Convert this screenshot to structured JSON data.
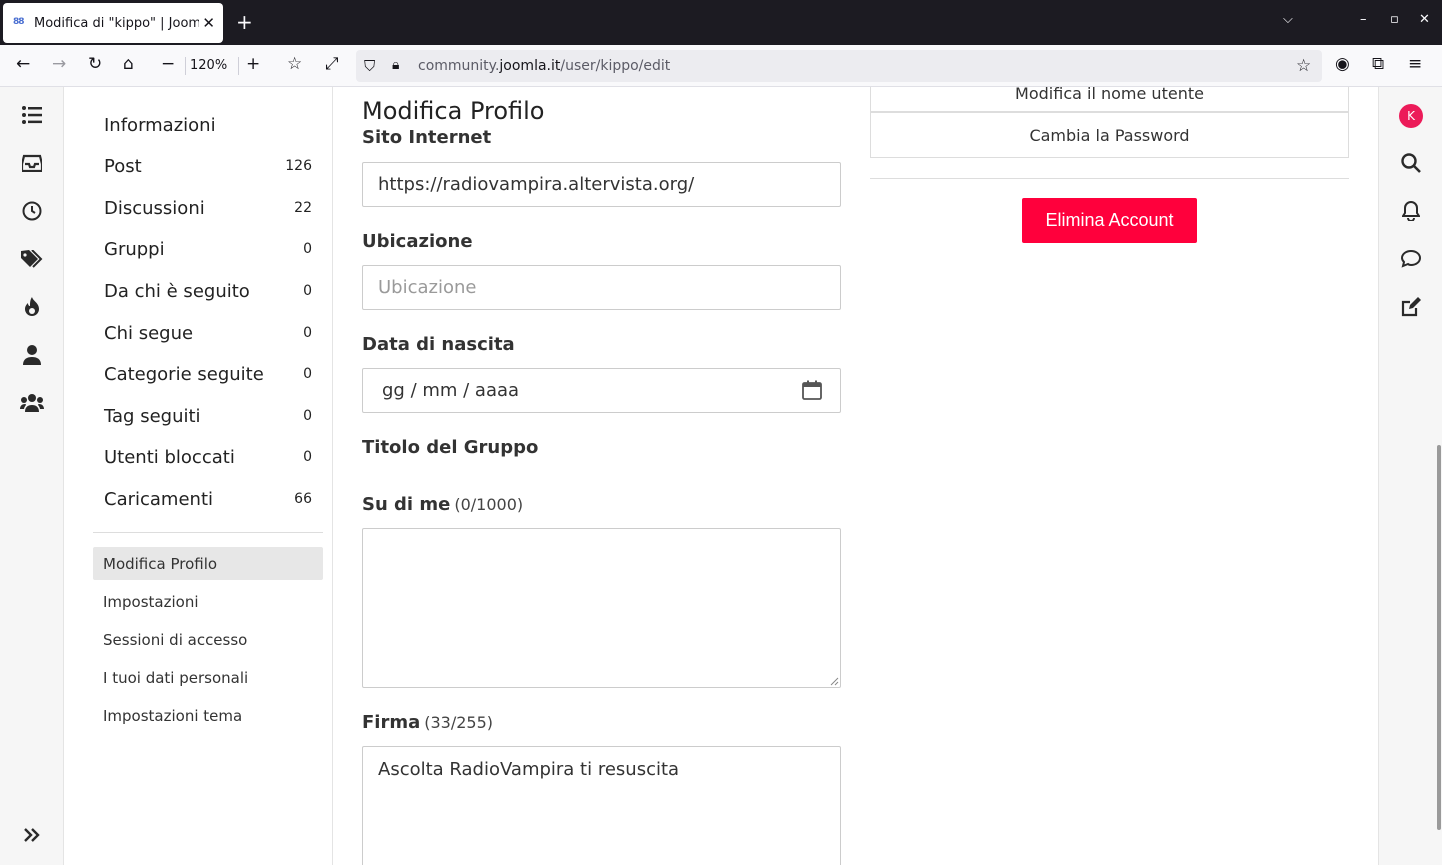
{
  "browser": {
    "tab_title": "Modifica di \"kippo\" | Joomla",
    "favicon_text": "88",
    "zoom": "120%",
    "url_prefix": "community.",
    "url_domain": "joomla.it",
    "url_path": "/user/kippo/edit"
  },
  "side_menu": {
    "heading": "Informazioni",
    "stats": [
      {
        "label": "Post",
        "count": "126"
      },
      {
        "label": "Discussioni",
        "count": "22"
      },
      {
        "label": "Gruppi",
        "count": "0"
      },
      {
        "label": "Da chi è seguito",
        "count": "0"
      },
      {
        "label": "Chi segue",
        "count": "0"
      },
      {
        "label": "Categorie seguite",
        "count": "0"
      },
      {
        "label": "Tag seguiti",
        "count": "0"
      },
      {
        "label": "Utenti bloccati",
        "count": "0"
      },
      {
        "label": "Caricamenti",
        "count": "66"
      }
    ],
    "links": [
      {
        "label": "Modifica Profilo",
        "active": true
      },
      {
        "label": "Impostazioni",
        "active": false
      },
      {
        "label": "Sessioni di accesso",
        "active": false
      },
      {
        "label": "I tuoi dati personali",
        "active": false
      },
      {
        "label": "Impostazioni tema",
        "active": false
      }
    ]
  },
  "form": {
    "title": "Modifica Profilo",
    "website_label": "Sito Internet",
    "website_value": "https://radiovampira.altervista.org/",
    "location_label": "Ubicazione",
    "location_placeholder": "Ubicazione",
    "birth_label": "Data di nascita",
    "birth_placeholder": "gg / mm / aaaa",
    "group_title_label": "Titolo del Gruppo",
    "about_label": "Su di me",
    "about_counter": "(0/1000)",
    "about_value": "",
    "signature_label": "Firma",
    "signature_counter": "(33/255)",
    "signature_value": "Ascolta RadioVampira ti resuscita"
  },
  "account": {
    "change_username": "Modifica il nome utente",
    "change_password": "Cambia la Password",
    "delete_account": "Elimina Account"
  },
  "user": {
    "avatar_letter": "K",
    "avatar_color": "#ec1b59"
  },
  "colors": {
    "danger": "#ff003c"
  }
}
